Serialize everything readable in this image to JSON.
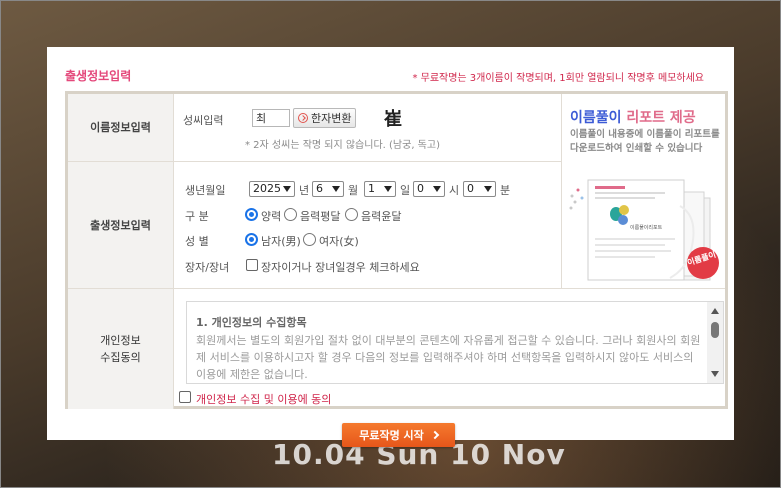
{
  "modal": {
    "title": "출생정보입력",
    "notice": "* 무료작명는 3개이름이 작명되며, 1회만 열람되니 작명후 메모하세요"
  },
  "name_section": {
    "label": "이름정보입력",
    "surname_label": "성씨입력",
    "surname_value": "최",
    "hanja_button": "한자변환",
    "hanja_char": "崔",
    "hint": "* 2자 성씨는 작명 되지 않습니다. (남궁, 독고)"
  },
  "birth_section": {
    "label": "출생정보입력",
    "date_label": "생년월일",
    "year": "2025",
    "year_unit": "년",
    "month": "6",
    "month_unit": "월",
    "day": "1",
    "day_unit": "일",
    "hour": "0",
    "hour_unit": "시",
    "minute": "0",
    "minute_unit": "분",
    "calendar_label": "구 분",
    "calendar_options": [
      "양력",
      "음력평달",
      "음력윤달"
    ],
    "calendar_selected": "양력",
    "gender_label": "성 별",
    "gender_options": [
      "남자(男)",
      "여자(女)"
    ],
    "gender_selected": "남자(男)",
    "eldest_label": "장자/장녀",
    "eldest_checkbox_label": "장자이거나 장녀일경우 체크하세요",
    "eldest_checked": false
  },
  "ad": {
    "title_prefix": "이름풀이",
    "title_highlight": "리포트 제공",
    "description": "이름풀이 내용중에 이름풀이 리포트를 다운로드하여 인쇄할 수 있습니다",
    "badge_text": "이름풀이",
    "doc_title": "이름풀이리포트"
  },
  "consent": {
    "label": "개인정보\n수집동의",
    "terms_heading": "1. 개인정보의 수집항목",
    "terms_body": "회원께서는 별도의 회원가입 절차 없이 대부분의 콘텐츠에 자유롭게 접근할 수 있습니다. 그러나 회원사의 회원제 서비스를 이용하시고자 할 경우 다음의 정보를 입력해주셔야 하며 선택항목을 입력하시지 않아도 서비스의 이용에 제한은 없습니다.",
    "agree_label": "개인정보 수집 및 이용에 동의",
    "agree_checked": false
  },
  "start_button": "무료작명 시작",
  "background_text": "10.04  Sun 10 Nov",
  "colors": {
    "title_pink": "#e4487b",
    "notice_red": "#d0264b",
    "ad_blue": "#3c5bd6",
    "button_orange": "#f06a26",
    "radio_blue": "#1a73e8"
  }
}
